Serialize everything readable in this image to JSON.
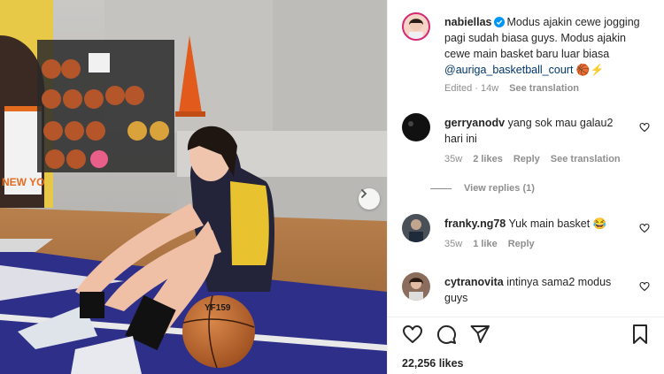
{
  "post": {
    "author": "nabiellas",
    "caption": "Modus ajakin cewe jogging pagi sudah biasa guys. Modus ajakin cewe main basket baru luar biasa",
    "mention": "@auriga_basketball_court",
    "emoji": "🏀⚡",
    "meta_edited": "Edited · 14w",
    "meta_translation": "See translation"
  },
  "comments": [
    {
      "user": "gerryanodv",
      "text": "yang sok mau galau2 hari ini",
      "age": "35w",
      "likes": "2 likes",
      "reply": "Reply",
      "translation": "See translation"
    },
    {
      "user": "franky.ng78",
      "text": "Yuk main basket 😂",
      "age": "35w",
      "likes": "1 like",
      "reply": "Reply"
    },
    {
      "user": "cytranovita",
      "text": "intinya sama2 modus guys"
    }
  ],
  "view_replies": "View replies (1)",
  "likes_count": "22,256 likes",
  "photo": {
    "ball_text": "YF159",
    "mural_text": "NEW YO"
  },
  "icons": [
    "verified-badge",
    "heart-icon",
    "comment-icon",
    "share-icon",
    "bookmark-icon",
    "chevron-right-icon"
  ],
  "colors": {
    "verified": "#0095f6",
    "link": "#00376b",
    "meta": "#8e8e8e"
  }
}
